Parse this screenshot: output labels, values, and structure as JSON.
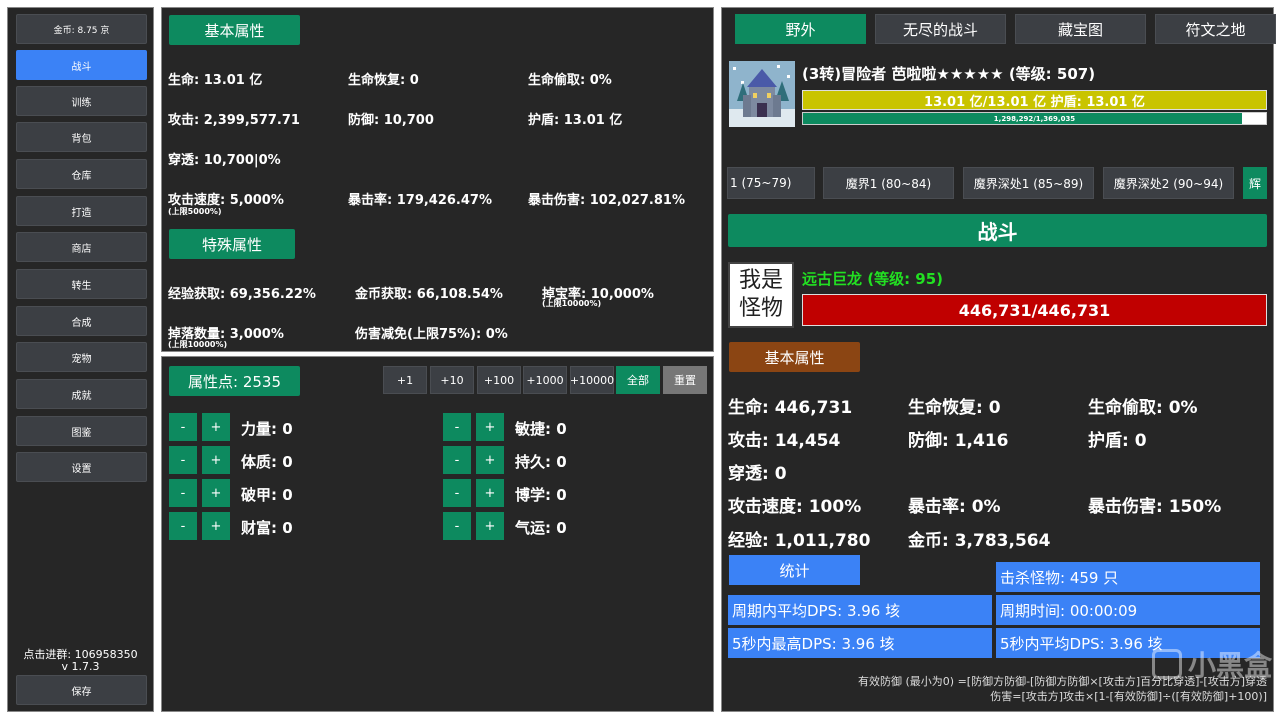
{
  "sidebar": {
    "gold": "金币: 8.75 京",
    "items": [
      "战斗",
      "训练",
      "背包",
      "仓库",
      "打造",
      "商店",
      "转生",
      "合成",
      "宠物",
      "成就",
      "图鉴",
      "设置"
    ],
    "active_index": 0,
    "group_text": "点击进群: 106958350",
    "version": "v 1.7.3",
    "save_label": "保存"
  },
  "stats": {
    "basic_header": "基本属性",
    "hp": "生命: 13.01 亿",
    "regen": "生命恢复: 0",
    "leech": "生命偷取: 0%",
    "atk": "攻击: 2,399,577.71",
    "def": "防御: 10,700",
    "shield": "护盾: 13.01 亿",
    "pen": "穿透: 10,700|0%",
    "atk_speed": "攻击速度: 5,000%",
    "atk_speed_cap": "(上限5000%)",
    "crit": "暴击率: 179,426.47%",
    "crit_dmg": "暴击伤害: 102,027.81%",
    "special_header": "特殊属性",
    "exp_gain": "经验获取: 69,356.22%",
    "gold_gain": "金币获取: 66,108.54%",
    "drop_rate": "掉宝率: 10,000%",
    "drop_rate_cap": "(上限10000%)",
    "drop_count": "掉落数量: 3,000%",
    "drop_count_cap": "(上限10000%)",
    "dmg_reduce": "伤害减免(上限75%): 0%"
  },
  "points": {
    "label": "属性点: 2535",
    "increments": [
      "+1",
      "+10",
      "+100",
      "+1000",
      "+10000",
      "全部",
      "重置"
    ],
    "minus": "-",
    "plus": "+",
    "attrs_left": [
      "力量: 0",
      "体质: 0",
      "破甲: 0",
      "财富: 0"
    ],
    "attrs_right": [
      "敏捷: 0",
      "持久: 0",
      "博学: 0",
      "气运: 0"
    ]
  },
  "right": {
    "tabs": [
      "野外",
      "无尽的战斗",
      "藏宝图",
      "符文之地"
    ],
    "player_title": "(3转)冒险者 芭啦啦★★★★★ (等级: 507)",
    "player_hp_text": "13.01 亿/13.01 亿 护盾: 13.01 亿",
    "player_exp_text": "1,298,292/1,369,035",
    "player_exp_fraction": 0.948,
    "zones": [
      "1 (75~79)",
      "魔界1 (80~84)",
      "魔界深处1 (85~89)",
      "魔界深处2 (90~94)",
      "辉"
    ],
    "fight_label": "战斗",
    "monster_badge": "我是怪物",
    "monster_title": "远古巨龙 (等级: 95)",
    "monster_hp_text": "446,731/446,731",
    "monster_hp_fraction": 1.0,
    "monster_header": "基本属性",
    "m_hp": "生命: 446,731",
    "m_regen": "生命恢复: 0",
    "m_leech": "生命偷取: 0%",
    "m_atk": "攻击: 14,454",
    "m_def": "防御: 1,416",
    "m_shield": "护盾: 0",
    "m_pen": "穿透: 0",
    "m_speed": "攻击速度: 100%",
    "m_crit": "暴击率: 0%",
    "m_critdmg": "暴击伤害: 150%",
    "m_exp": "经验: 1,011,780",
    "m_gold": "金币: 3,783,564",
    "stats_btn": "统计",
    "kills": "击杀怪物: 459 只",
    "avg_dps": "周期内平均DPS: 3.96 垓",
    "period": "周期时间: 00:00:09",
    "max_dps5": "5秒内最高DPS: 3.96 垓",
    "avg_dps5": "5秒内平均DPS: 3.96 垓",
    "formula1": "有效防御 (最小为0) =[防御方防御-[防御方防御×[攻击方]百分比穿透]-[攻击方]穿透",
    "formula2": "伤害=[攻击方]攻击×[1-[有效防御]÷([有效防御]+100)]",
    "watermark": "小黑盒"
  },
  "colors": {
    "panel": "#262626",
    "green": "#0d8a5f",
    "blue": "#3b82f6",
    "yellow_bar": "#c9c400",
    "red_bar": "#c00000",
    "brown": "#8b4513"
  }
}
